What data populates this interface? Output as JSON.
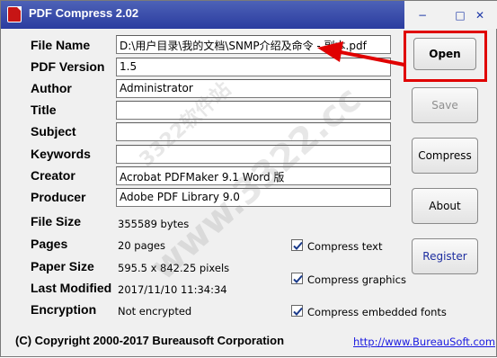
{
  "window": {
    "title": "PDF Compress 2.02",
    "controls": {
      "minimize": "−",
      "maximize": "□",
      "close": "✕"
    }
  },
  "fields": [
    {
      "label": "File Name",
      "value": "D:\\用户目录\\我的文档\\SNMP介绍及命令 - 副本.pdf"
    },
    {
      "label": "PDF Version",
      "value": "1.5"
    },
    {
      "label": "Author",
      "value": "Administrator"
    },
    {
      "label": "Title",
      "value": ""
    },
    {
      "label": "Subject",
      "value": ""
    },
    {
      "label": "Keywords",
      "value": ""
    },
    {
      "label": "Creator",
      "value": "Acrobat PDFMaker 9.1 Word 版"
    },
    {
      "label": "Producer",
      "value": "Adobe PDF Library 9.0"
    }
  ],
  "info": [
    {
      "label": "File Size",
      "value": "355589 bytes"
    },
    {
      "label": "Pages",
      "value": "20 pages"
    },
    {
      "label": "Paper Size",
      "value": "595.5 x 842.25 pixels"
    },
    {
      "label": "Last Modified",
      "value": "2017/11/10 11:34:34"
    },
    {
      "label": "Encryption",
      "value": "Not encrypted"
    }
  ],
  "options": [
    {
      "label": "Compress text",
      "checked": true
    },
    {
      "label": "Compress graphics",
      "checked": true
    },
    {
      "label": "Compress embedded fonts",
      "checked": true
    }
  ],
  "buttons": {
    "open": "Open",
    "save": "Save",
    "compress": "Compress",
    "about": "About",
    "register": "Register"
  },
  "footer": {
    "copyright": "(C) Copyright 2000-2017 Bureausoft Corporation",
    "link": "http://www.BureauSoft.com"
  },
  "watermark": {
    "main": "www.3322.cc",
    "sub": "3322软件站"
  },
  "colors": {
    "titlebar": "#2b3c9f",
    "highlight": "#e00000",
    "link": "#1a1ae0"
  }
}
